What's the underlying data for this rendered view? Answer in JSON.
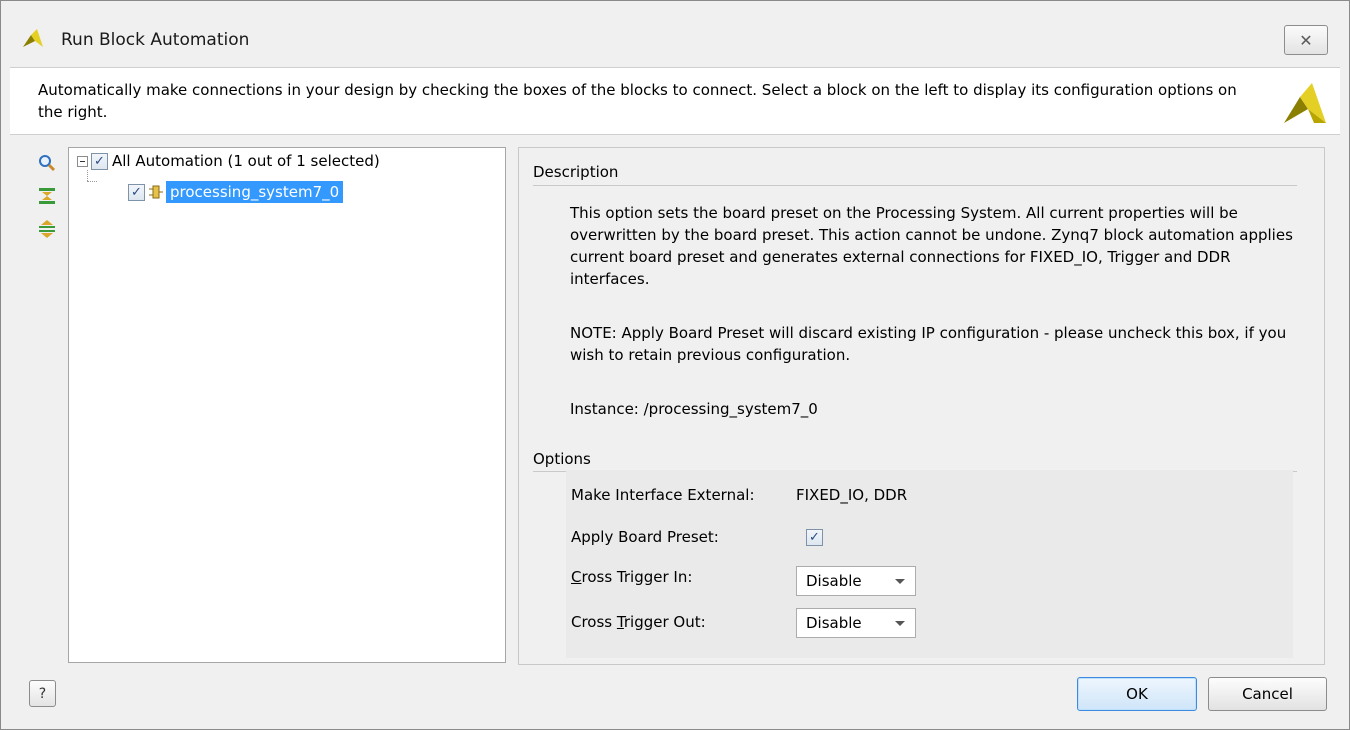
{
  "window": {
    "title": "Run Block Automation",
    "close_glyph": "✕"
  },
  "banner": {
    "text": "Automatically make connections in your design by checking the boxes of the blocks to connect. Select a block on the left to display its configuration options on the right."
  },
  "toolbar": {
    "icons": [
      "search-icon",
      "collapse-all-icon",
      "expand-all-icon"
    ]
  },
  "tree": {
    "root_label": "All Automation (1 out of 1 selected)",
    "root_checked": true,
    "child_label": "processing_system7_0",
    "child_checked": true
  },
  "description": {
    "heading": "Description",
    "paragraph1": "This option sets the board preset on the Processing System. All current properties will be overwritten by the board preset. This action cannot be undone. Zynq7 block automation applies current board preset and generates external connections for FIXED_IO, Trigger and DDR interfaces.",
    "paragraph2": "NOTE: Apply Board Preset will discard existing IP configuration - please uncheck this box, if you wish to retain previous configuration.",
    "instance": "Instance: /processing_system7_0"
  },
  "options": {
    "heading": "Options",
    "make_external_label": "Make Interface External:",
    "make_external_value": "FIXED_IO, DDR",
    "apply_preset_label": "Apply Board Preset:",
    "apply_preset_checked": true,
    "cross_in_label_pre": "",
    "cross_in_label_u": "C",
    "cross_in_label_post": "ross Trigger In:",
    "cross_in_value": "Disable",
    "cross_out_label_pre": "Cross ",
    "cross_out_label_u": "T",
    "cross_out_label_post": "rigger Out:",
    "cross_out_value": "Disable"
  },
  "buttons": {
    "help": "?",
    "ok": "OK",
    "cancel": "Cancel"
  },
  "colors": {
    "selection": "#3399ff",
    "xilinx_logo": "#c8b400"
  }
}
